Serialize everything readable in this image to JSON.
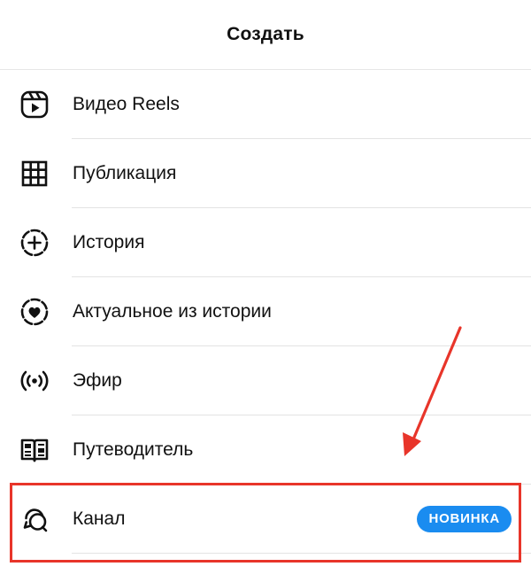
{
  "header": {
    "title": "Создать"
  },
  "menu": {
    "items": [
      {
        "label": "Видео Reels",
        "icon": "reels-icon"
      },
      {
        "label": "Публикация",
        "icon": "grid-icon"
      },
      {
        "label": "История",
        "icon": "story-add-icon"
      },
      {
        "label": "Актуальное из истории",
        "icon": "highlight-heart-icon"
      },
      {
        "label": "Эфир",
        "icon": "live-broadcast-icon"
      },
      {
        "label": "Путеводитель",
        "icon": "guide-book-icon"
      },
      {
        "label": "Канал",
        "icon": "channel-chat-icon",
        "badge": "НОВИНКА"
      }
    ]
  },
  "colors": {
    "badge": "#1a8cf0",
    "annotation": "#e8352a"
  }
}
